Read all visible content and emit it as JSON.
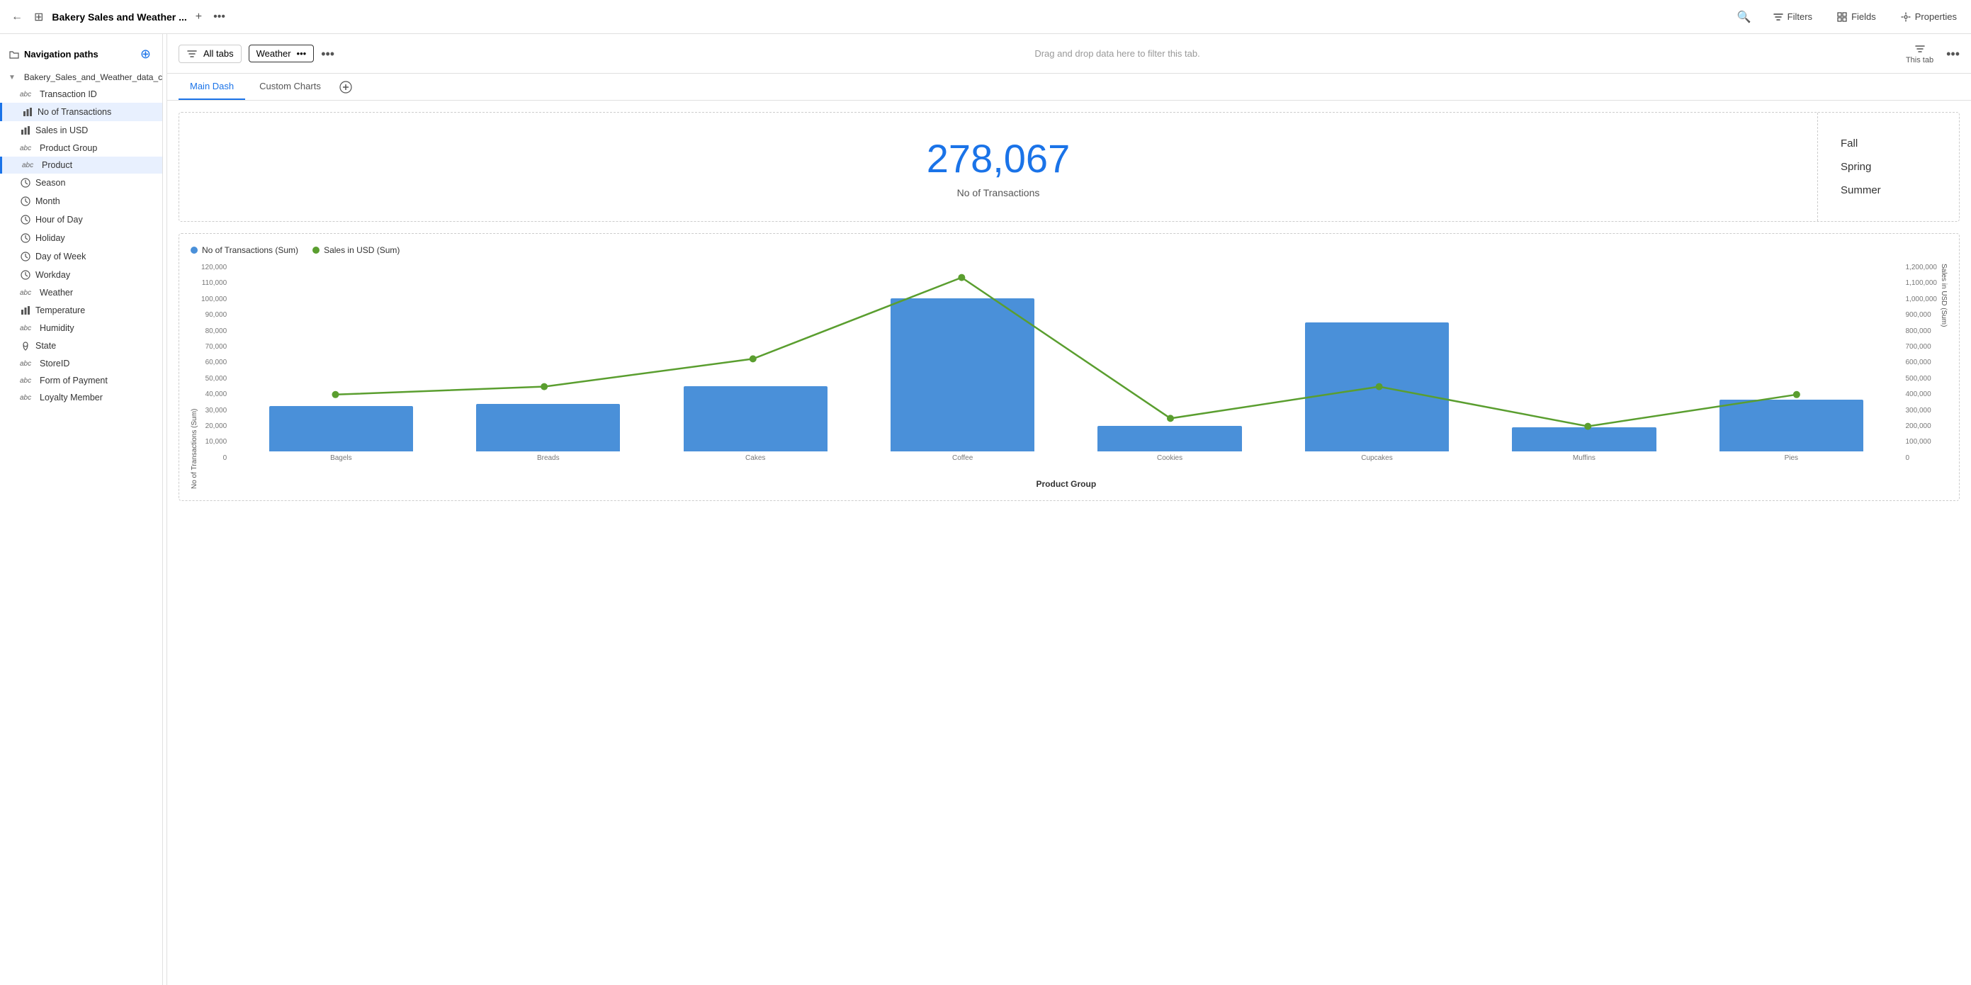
{
  "topbar": {
    "back_icon": "←",
    "grid_icon": "⊞",
    "title": "Bakery Sales and Weather ...",
    "add_icon": "+",
    "more_icon": "•••",
    "search_icon": "🔍",
    "filters_label": "Filters",
    "fields_label": "Fields",
    "properties_label": "Properties"
  },
  "sidebar": {
    "nav_label": "Navigation paths",
    "add_icon": "+",
    "source_label": "Bakery_Sales_and_Weather_data_csv",
    "items": [
      {
        "id": "transaction-id",
        "type": "abc",
        "label": "Transaction ID",
        "active": false
      },
      {
        "id": "no-of-transactions",
        "type": "bar",
        "label": "No of Transactions",
        "active": true,
        "color": "blue"
      },
      {
        "id": "sales-in-usd",
        "type": "bar",
        "label": "Sales in USD",
        "active": false
      },
      {
        "id": "product-group",
        "type": "abc",
        "label": "Product Group",
        "active": false
      },
      {
        "id": "product",
        "type": "abc",
        "label": "Product",
        "active": true,
        "color": "blue"
      },
      {
        "id": "season",
        "type": "clock",
        "label": "Season",
        "active": false
      },
      {
        "id": "month",
        "type": "clock",
        "label": "Month",
        "active": false
      },
      {
        "id": "hour-of-day",
        "type": "clock",
        "label": "Hour of Day",
        "active": false
      },
      {
        "id": "holiday",
        "type": "clock",
        "label": "Holiday",
        "active": false
      },
      {
        "id": "day-of-week",
        "type": "clock",
        "label": "Day of Week",
        "active": false
      },
      {
        "id": "workday",
        "type": "clock",
        "label": "Workday",
        "active": false
      },
      {
        "id": "weather",
        "type": "abc",
        "label": "Weather",
        "active": false
      },
      {
        "id": "temperature",
        "type": "bar",
        "label": "Temperature",
        "active": false
      },
      {
        "id": "humidity",
        "type": "abc",
        "label": "Humidity",
        "active": false
      },
      {
        "id": "state",
        "type": "pin",
        "label": "State",
        "active": false
      },
      {
        "id": "store-id",
        "type": "abc",
        "label": "StoreID",
        "active": false
      },
      {
        "id": "form-of-payment",
        "type": "abc",
        "label": "Form of Payment",
        "active": false
      },
      {
        "id": "loyalty-member",
        "type": "abc",
        "label": "Loyalty Member",
        "active": false
      }
    ]
  },
  "filter_bar": {
    "all_tabs_icon": "▽",
    "all_tabs_label": "All tabs",
    "weather_tag": "Weather",
    "weather_dots": "•••",
    "more_dots": "•••",
    "this_tab_icon": "▽",
    "this_tab_label": "This tab",
    "drop_hint": "Drag and drop data here to filter this tab.",
    "right_dots": "•••"
  },
  "tabs": {
    "items": [
      {
        "id": "main-dash",
        "label": "Main Dash",
        "active": true
      },
      {
        "id": "custom-charts",
        "label": "Custom Charts",
        "active": false
      }
    ],
    "add_icon": "+"
  },
  "kpi": {
    "value": "278,067",
    "label": "No of Transactions"
  },
  "filter_list": {
    "items": [
      "Fall",
      "Spring",
      "Summer"
    ]
  },
  "chart": {
    "legend": [
      {
        "id": "transactions",
        "color": "#4a90d9",
        "label": "No of Transactions (Sum)"
      },
      {
        "id": "sales",
        "color": "#5a9e2f",
        "label": "Sales in USD (Sum)"
      }
    ],
    "y_left_ticks": [
      "120,000",
      "110,000",
      "100,000",
      "90,000",
      "80,000",
      "70,000",
      "60,000",
      "50,000",
      "40,000",
      "30,000",
      "20,000",
      "10,000",
      "0"
    ],
    "y_right_ticks": [
      "1,200,000",
      "1,100,000",
      "1,000,000",
      "900,000",
      "800,000",
      "700,000",
      "600,000",
      "500,000",
      "400,000",
      "300,000",
      "200,000",
      "100,000",
      "0"
    ],
    "y_left_title": "No of Transactions (Sum)",
    "y_right_title": "Sales in USD (Sum)",
    "x_title": "Product Group",
    "bars": [
      {
        "label": "Bagels",
        "height_pct": 23,
        "value": 27000
      },
      {
        "label": "Breads",
        "height_pct": 24,
        "value": 28000
      },
      {
        "label": "Cakes",
        "height_pct": 33,
        "value": 42000
      },
      {
        "label": "Coffee",
        "height_pct": 77,
        "value": 92000
      },
      {
        "label": "Cookies",
        "height_pct": 13,
        "value": 16000
      },
      {
        "label": "Cupcakes",
        "height_pct": 65,
        "value": 78000
      },
      {
        "label": "Muffins",
        "height_pct": 12,
        "value": 14000
      },
      {
        "label": "Pies",
        "height_pct": 26,
        "value": 30000
      }
    ],
    "line_points_pct": [
      34,
      38,
      52,
      93,
      22,
      38,
      18,
      34
    ]
  }
}
